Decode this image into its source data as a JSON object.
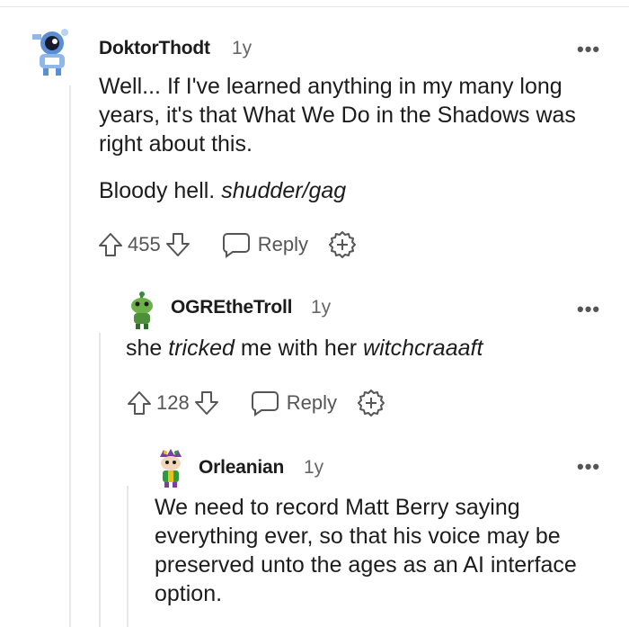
{
  "comments": [
    {
      "username": "DoktorThodt",
      "age": "1y",
      "paragraphs": [
        "Well... If I've learned anything in my many long years, it's that What We Do in the Shadows was right about this."
      ],
      "line2_plain": "Bloody hell. ",
      "line2_italic": "shudder/gag",
      "score": "455",
      "reply_label": "Reply",
      "more_label": "•••"
    },
    {
      "username": "OGREtheTroll",
      "age": "1y",
      "text_a": "she ",
      "text_b": "tricked",
      "text_c": " me with her ",
      "text_d": "witchcraaaft",
      "score": "128",
      "reply_label": "Reply",
      "more_label": "•••"
    },
    {
      "username": "Orleanian",
      "age": "1y",
      "text": "We need to record Matt Berry saying everything ever, so that his voice may be preserved unto the ages as an AI interface option.",
      "more_label": "•••"
    }
  ]
}
